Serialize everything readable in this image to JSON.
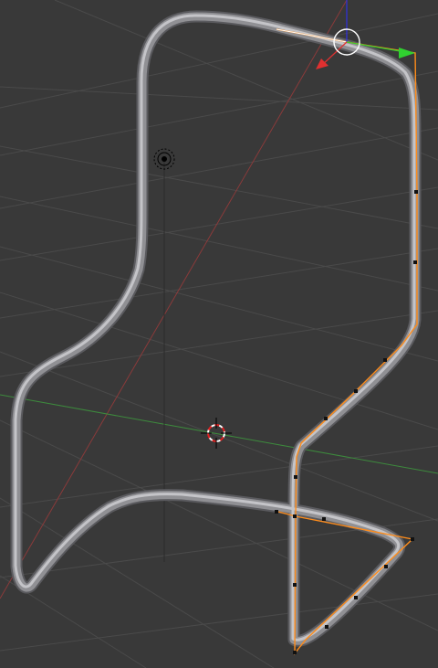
{
  "viewport": {
    "background": "#393939",
    "grid_color": "#4a4a4a",
    "x_axis_color": "#8a3a3a",
    "y_axis_color": "#3d8a3d",
    "z_axis_color": "#2a2ad0"
  },
  "object": {
    "type": "curve",
    "tube_color": "#8c8c90",
    "tube_highlight": "#c4c4c8",
    "selection_color": "#ff8c1a"
  },
  "gizmo": {
    "x_handle_color": "#e03030",
    "y_handle_color": "#30d030",
    "z_handle_color": "#3030e0"
  },
  "icons": {
    "cursor": "3d-cursor-icon",
    "lamp": "lamp-icon",
    "origin": "object-origin-icon",
    "manipulator": "transform-manipulator-icon"
  }
}
